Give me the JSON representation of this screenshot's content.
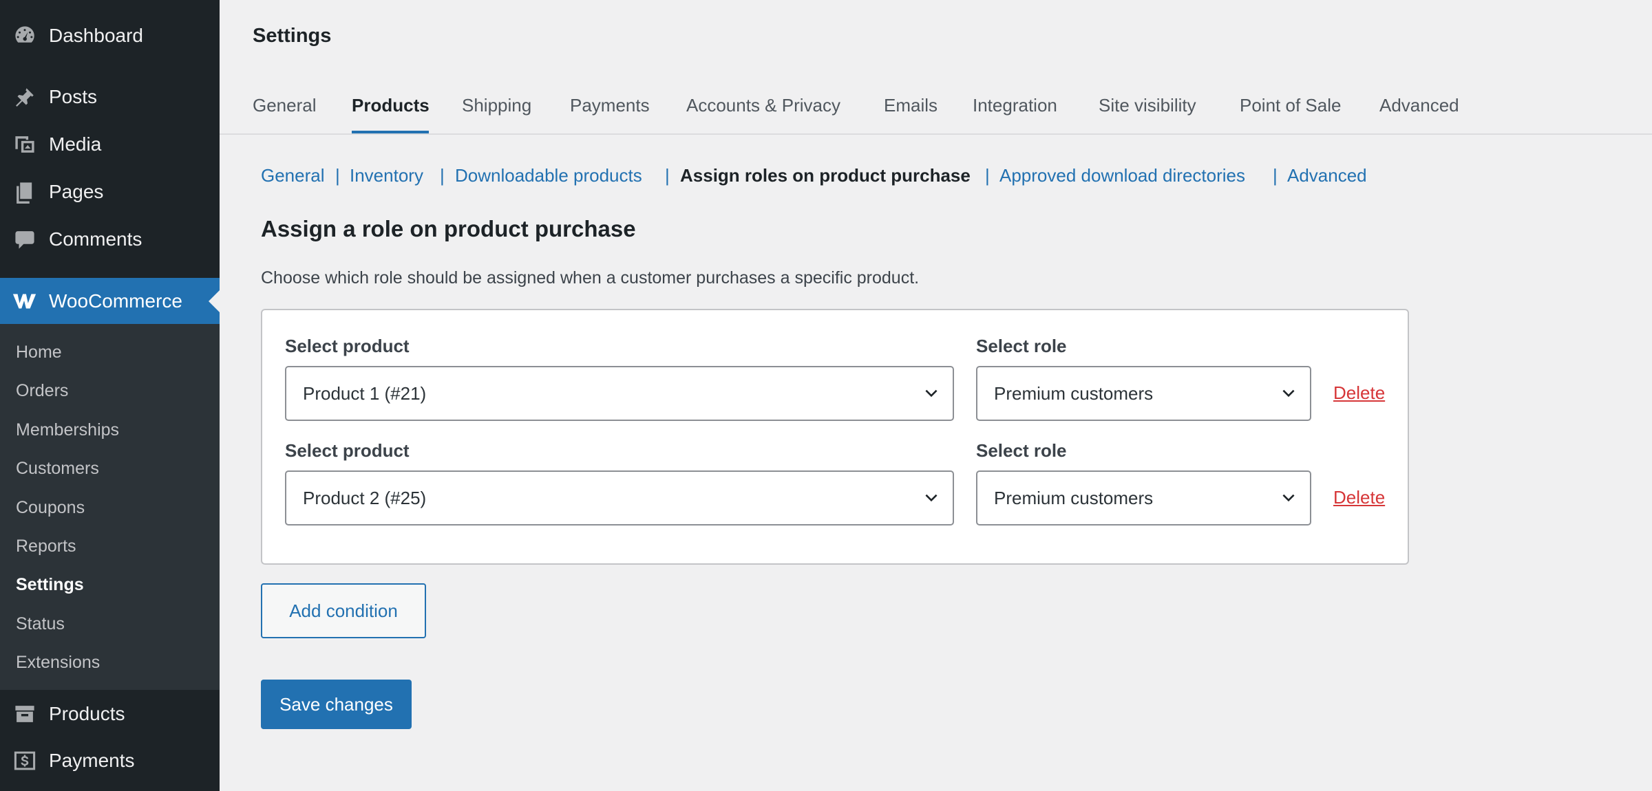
{
  "sidebar": {
    "top_items": [
      {
        "label": "Dashboard",
        "icon": "dashboard-icon"
      },
      {
        "label": "Posts",
        "icon": "pin-icon"
      },
      {
        "label": "Media",
        "icon": "media-icon"
      },
      {
        "label": "Pages",
        "icon": "pages-icon"
      },
      {
        "label": "Comments",
        "icon": "comment-icon"
      }
    ],
    "woocommerce": {
      "label": "WooCommerce",
      "icon": "woocommerce-icon"
    },
    "submenu": [
      "Home",
      "Orders",
      "Memberships",
      "Customers",
      "Coupons",
      "Reports",
      "Settings",
      "Status",
      "Extensions"
    ],
    "submenu_current": "Settings",
    "bottom_items": [
      {
        "label": "Products",
        "icon": "archive-icon"
      },
      {
        "label": "Payments",
        "icon": "dollar-icon"
      }
    ]
  },
  "header": {
    "title": "Settings",
    "tabs": [
      "General",
      "Products",
      "Shipping",
      "Payments",
      "Accounts & Privacy",
      "Emails",
      "Integration",
      "Site visibility",
      "Point of Sale",
      "Advanced"
    ],
    "active_tab": "Products"
  },
  "subnav": {
    "links": [
      "General",
      "Inventory",
      "Downloadable products",
      "Assign roles on product purchase",
      "Approved download directories",
      "Advanced"
    ],
    "separator": "|",
    "current": "Assign roles on product purchase"
  },
  "section": {
    "title": "Assign a role on product purchase",
    "description": "Choose which role should be assigned when a customer purchases a specific product."
  },
  "conditions": [
    {
      "product_label": "Select product",
      "product_value": "Product 1 (#21)",
      "role_label": "Select role",
      "role_value": "Premium customers",
      "delete_label": "Delete"
    },
    {
      "product_label": "Select product",
      "product_value": "Product 2 (#25)",
      "role_label": "Select role",
      "role_value": "Premium customers",
      "delete_label": "Delete"
    }
  ],
  "buttons": {
    "add_condition": "Add condition",
    "save": "Save changes"
  },
  "colors": {
    "sidebar_bg": "#1d2327",
    "submenu_bg": "#2c3338",
    "accent": "#2271b1",
    "delete": "#d63638"
  }
}
